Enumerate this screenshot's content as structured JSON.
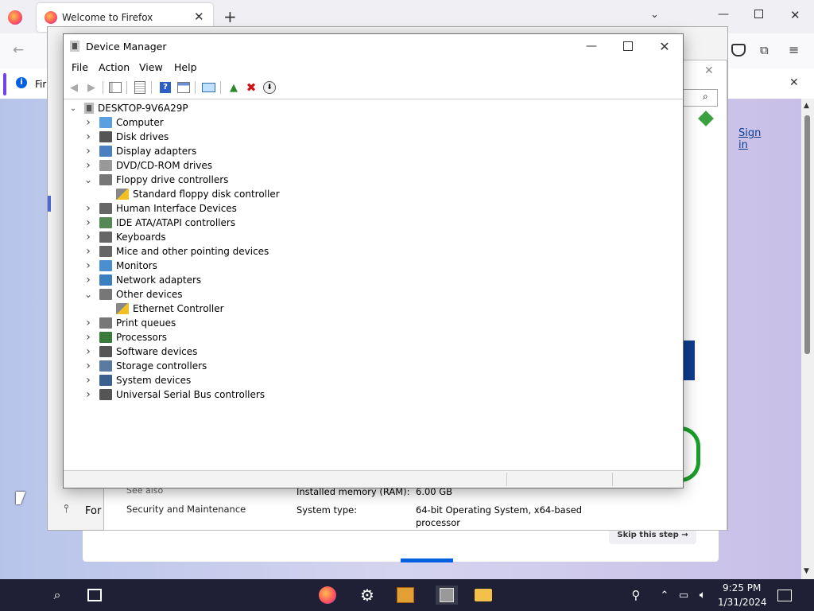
{
  "firefox": {
    "tab_title": "Welcome to Firefox",
    "notification_text": "Fir",
    "signin": "Sign in",
    "skip": "Skip this step",
    "skip_arrow": "→"
  },
  "system_panel": {
    "see_also": "See also",
    "sec_maint": "Security and Maintenance",
    "for_label": "For",
    "installed_memory_label": "Installed memory (RAM):",
    "installed_memory_value": "6.00 GB",
    "system_type_label": "System type:",
    "system_type_value_1": "64-bit Operating System, x64-based",
    "system_type_value_2": "processor"
  },
  "device_manager": {
    "title": "Device Manager",
    "menu": [
      "File",
      "Action",
      "View",
      "Help"
    ],
    "root": "DESKTOP-9V6A29P",
    "tree": [
      {
        "label": "Computer",
        "expanded": false,
        "child": false
      },
      {
        "label": "Disk drives",
        "expanded": false,
        "child": false
      },
      {
        "label": "Display adapters",
        "expanded": false,
        "child": false
      },
      {
        "label": "DVD/CD-ROM drives",
        "expanded": false,
        "child": false
      },
      {
        "label": "Floppy drive controllers",
        "expanded": true,
        "child": false
      },
      {
        "label": "Standard floppy disk controller",
        "expanded": false,
        "child": true
      },
      {
        "label": "Human Interface Devices",
        "expanded": false,
        "child": false
      },
      {
        "label": "IDE ATA/ATAPI controllers",
        "expanded": false,
        "child": false
      },
      {
        "label": "Keyboards",
        "expanded": false,
        "child": false
      },
      {
        "label": "Mice and other pointing devices",
        "expanded": false,
        "child": false
      },
      {
        "label": "Monitors",
        "expanded": false,
        "child": false
      },
      {
        "label": "Network adapters",
        "expanded": false,
        "child": false
      },
      {
        "label": "Other devices",
        "expanded": true,
        "child": false
      },
      {
        "label": "Ethernet Controller",
        "expanded": false,
        "child": true
      },
      {
        "label": "Print queues",
        "expanded": false,
        "child": false
      },
      {
        "label": "Processors",
        "expanded": false,
        "child": false
      },
      {
        "label": "Software devices",
        "expanded": false,
        "child": false
      },
      {
        "label": "Storage controllers",
        "expanded": false,
        "child": false
      },
      {
        "label": "System devices",
        "expanded": false,
        "child": false
      },
      {
        "label": "Universal Serial Bus controllers",
        "expanded": false,
        "child": false
      }
    ]
  },
  "taskbar": {
    "time": "9:25 PM",
    "date": "1/31/2024"
  },
  "colors": {
    "taskbar_bg": "#1f1f35",
    "delete_red": "#d01010",
    "link_blue": "#0060df"
  }
}
